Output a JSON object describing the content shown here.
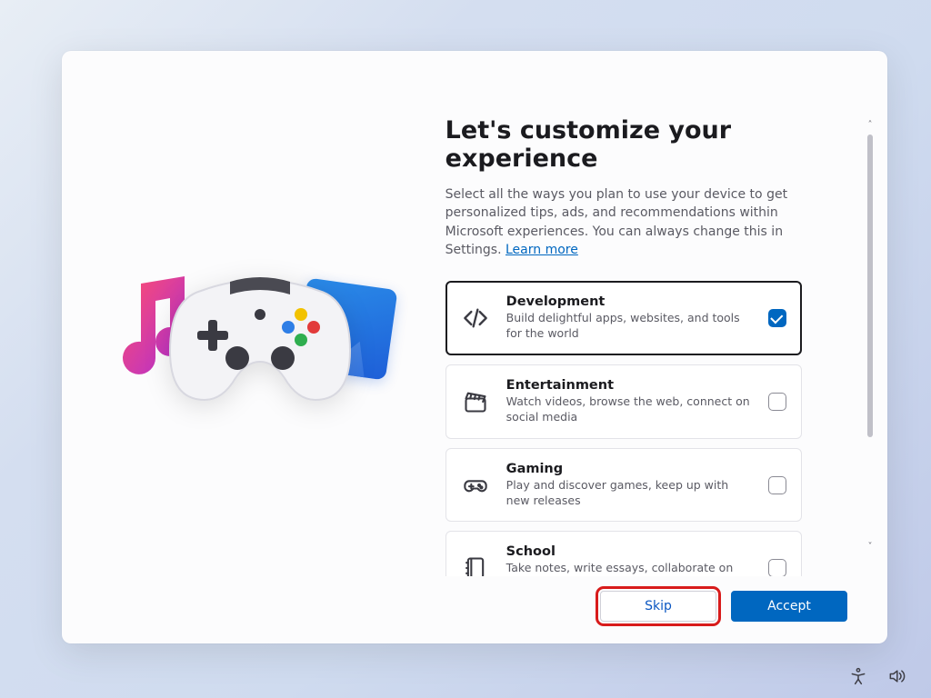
{
  "header": {
    "title": "Let's customize your experience",
    "subtitle_pre": "Select all the ways you plan to use your device to get personalized tips, ads, and recommendations within Microsoft experiences. You can always change this in Settings. ",
    "learn_more": "Learn more"
  },
  "options": [
    {
      "icon": "code-icon",
      "title": "Development",
      "desc": "Build delightful apps, websites, and tools for the world",
      "checked": true
    },
    {
      "icon": "clapper-icon",
      "title": "Entertainment",
      "desc": "Watch videos, browse the web, connect on social media",
      "checked": false
    },
    {
      "icon": "gamepad-icon",
      "title": "Gaming",
      "desc": "Play and discover games, keep up with new releases",
      "checked": false
    },
    {
      "icon": "notebook-icon",
      "title": "School",
      "desc": "Take notes, write essays, collaborate on projects",
      "checked": false
    }
  ],
  "footer": {
    "skip": "Skip",
    "accept": "Accept"
  },
  "taskbar": {
    "accessibility": "accessibility-icon",
    "volume": "volume-icon"
  },
  "colors": {
    "accent": "#0067c0",
    "highlight": "#d81b1b"
  }
}
